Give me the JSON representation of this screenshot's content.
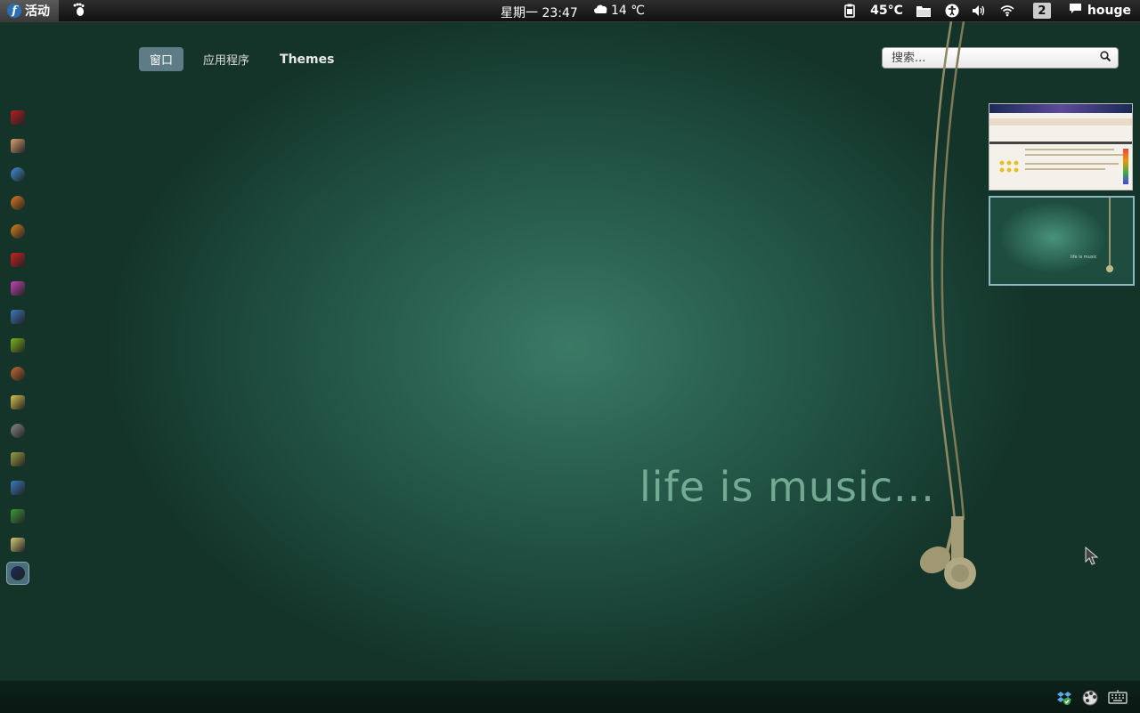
{
  "top_panel": {
    "activities_label": "活动",
    "clock": "星期一 23:47",
    "weather_temp": "14 ℃",
    "cpu_temp": "45°C",
    "workspace_number": "2",
    "user_name": "houge"
  },
  "view_selector": {
    "tabs": [
      {
        "label": "窗口",
        "active": true
      },
      {
        "label": "应用程序",
        "active": false
      },
      {
        "label": "Themes",
        "active": false
      }
    ]
  },
  "search": {
    "placeholder": "搜索..."
  },
  "dash": {
    "apps": [
      {
        "icon": "terminal-icon",
        "color": "#b51f1f"
      },
      {
        "icon": "evince-icon",
        "color": "#d9a070"
      },
      {
        "icon": "chrome-icon",
        "color": "#3d8fd8"
      },
      {
        "icon": "firefox-icon",
        "color": "#e07a1e"
      },
      {
        "icon": "firefox-alt-icon",
        "color": "#d9801d"
      },
      {
        "icon": "opera-icon",
        "color": "#cc1f1f"
      },
      {
        "icon": "music-player-icon",
        "color": "#c045b5"
      },
      {
        "icon": "chat-icon",
        "color": "#3b78c0"
      },
      {
        "icon": "hash-app-icon",
        "color": "#7fb21f"
      },
      {
        "icon": "media-icon",
        "color": "#c86a30"
      },
      {
        "icon": "image-viewer-icon",
        "color": "#d8c050"
      },
      {
        "icon": "disk-icon",
        "color": "#888888"
      },
      {
        "icon": "books-icon",
        "color": "#9aa040"
      },
      {
        "icon": "writer-icon",
        "color": "#3a7ac0"
      },
      {
        "icon": "calc-icon",
        "color": "#3a9a3a"
      },
      {
        "icon": "text-editor-icon",
        "color": "#d8c878"
      },
      {
        "icon": "system-monitor-icon",
        "color": "#1a2a5a"
      }
    ]
  },
  "wallpaper": {
    "text": "life is music..."
  },
  "workspaces": {
    "thumbs": [
      {
        "type": "browser",
        "label": ""
      },
      {
        "type": "desktop",
        "label": "life is music"
      }
    ]
  },
  "colors": {
    "accent": "#5e7c86",
    "background": "#2a6151",
    "panel": "#111111"
  }
}
